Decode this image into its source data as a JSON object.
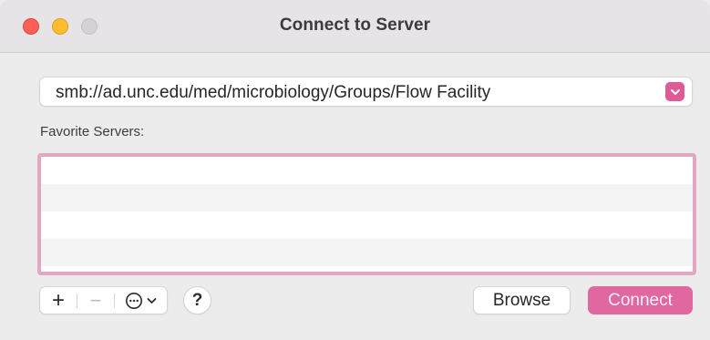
{
  "window": {
    "title": "Connect to Server"
  },
  "address": {
    "value": "smb://ad.unc.edu/med/microbiology/Groups/Flow Facility",
    "dropdown_icon": "chevron-down-icon"
  },
  "favorites": {
    "label": "Favorite Servers:",
    "items": []
  },
  "toolbar": {
    "add_label": "+",
    "remove_label": "−",
    "more_icon": "ellipsis-circle-icon",
    "help_label": "?"
  },
  "buttons": {
    "browse_label": "Browse",
    "connect_label": "Connect"
  },
  "colors": {
    "accent": "#e0679f",
    "list_focus_ring": "#e3a6c3"
  }
}
